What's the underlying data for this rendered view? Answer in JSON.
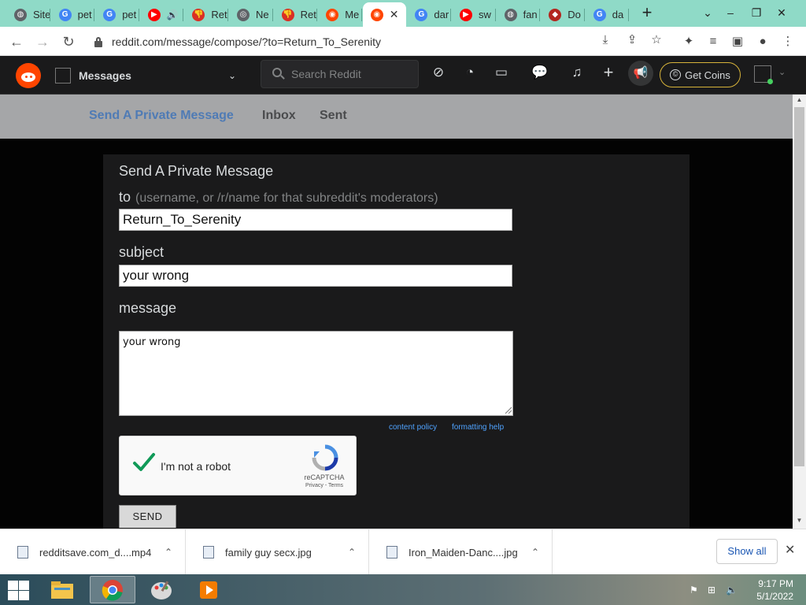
{
  "browser": {
    "tabs": [
      {
        "label": "Site",
        "favicon": "globe-icon",
        "color": "#5f6368"
      },
      {
        "label": "pet",
        "favicon": "google-icon",
        "color": "#4285f4"
      },
      {
        "label": "pet",
        "favicon": "google-icon",
        "color": "#4285f4"
      },
      {
        "label": "",
        "favicon": "youtube-icon",
        "color": "#ff0000",
        "audio": true
      },
      {
        "label": "Ret",
        "favicon": "thumbs-down-icon",
        "color": "#d93025"
      },
      {
        "label": "Ne",
        "favicon": "chrome-icon",
        "color": "#5f6368"
      },
      {
        "label": "Ret",
        "favicon": "thumbs-down-icon",
        "color": "#d93025"
      },
      {
        "label": "Me",
        "favicon": "reddit-icon",
        "color": "#ff4500"
      },
      {
        "label": "",
        "favicon": "reddit-icon",
        "color": "#ff4500",
        "active": true
      },
      {
        "label": "dar",
        "favicon": "google-icon",
        "color": "#4285f4"
      },
      {
        "label": "sw",
        "favicon": "youtube-icon",
        "color": "#ff0000"
      },
      {
        "label": "fan",
        "favicon": "globe-icon",
        "color": "#5f6368"
      },
      {
        "label": "Do",
        "favicon": "generic-icon",
        "color": "#b3261e"
      },
      {
        "label": "da",
        "favicon": "google-icon",
        "color": "#4285f4"
      }
    ],
    "url": "reddit.com/message/compose/?to=Return_To_Serenity"
  },
  "reddit_header": {
    "community_label": "Messages",
    "search_placeholder": "Search Reddit",
    "coins_label": "Get Coins"
  },
  "message_nav": {
    "compose": "Send A Private Message",
    "inbox": "Inbox",
    "sent": "Sent"
  },
  "compose": {
    "title": "Send A Private Message",
    "to_label": "to",
    "to_hint": "(username, or /r/name for that subreddit's moderators)",
    "to_value": "Return_To_Serenity",
    "subject_label": "subject",
    "subject_value": "your wrong",
    "message_label": "message",
    "message_value": "your wrong",
    "content_policy": "content policy",
    "formatting_help": "formatting help",
    "send_label": "SEND"
  },
  "captcha": {
    "label": "I'm not a robot",
    "brand": "reCAPTCHA",
    "terms": "Privacy - Terms",
    "checked": true
  },
  "downloads": {
    "items": [
      {
        "name": "redditsave.com_d....mp4",
        "icon": "video-file-icon"
      },
      {
        "name": "family guy secx.jpg",
        "icon": "image-file-icon"
      },
      {
        "name": "Iron_Maiden-Danc....jpg",
        "icon": "image-file-icon"
      }
    ],
    "show_all": "Show all"
  },
  "taskbar": {
    "time": "9:17 PM",
    "date": "5/1/2022"
  },
  "colors": {
    "reddit_orange": "#ff4500",
    "link_blue": "#4fa3ff",
    "tab_strip": "#8fdac7",
    "panel": "#1a1a1b"
  }
}
